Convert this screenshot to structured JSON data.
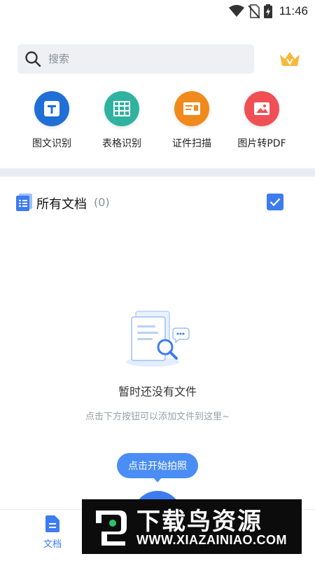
{
  "status_bar": {
    "time": "11:46"
  },
  "search": {
    "placeholder": "搜索"
  },
  "features": [
    {
      "label": "图文识别",
      "color": "#1f6fd6",
      "icon": "text-recognition-icon"
    },
    {
      "label": "表格识别",
      "color": "#2fb3a0",
      "icon": "table-recognition-icon"
    },
    {
      "label": "证件扫描",
      "color": "#f08a1c",
      "icon": "id-card-icon"
    },
    {
      "label": "图片转PDF",
      "color": "#f04f56",
      "icon": "image-icon"
    }
  ],
  "documents": {
    "title": "所有文档",
    "count": "(0)"
  },
  "empty_state": {
    "title": "暂时还没有文件",
    "hint": "点击下方按钮可以添加文件到这里~"
  },
  "camera": {
    "tooltip": "点击开始拍照"
  },
  "bottom_nav": {
    "docs_label": "文档"
  },
  "watermark": {
    "title": "下载鸟资源",
    "url": "WWW.XIAZAINIAO.COM"
  },
  "colors": {
    "accent": "#3d7cf0",
    "divider": "#e9edf3"
  }
}
